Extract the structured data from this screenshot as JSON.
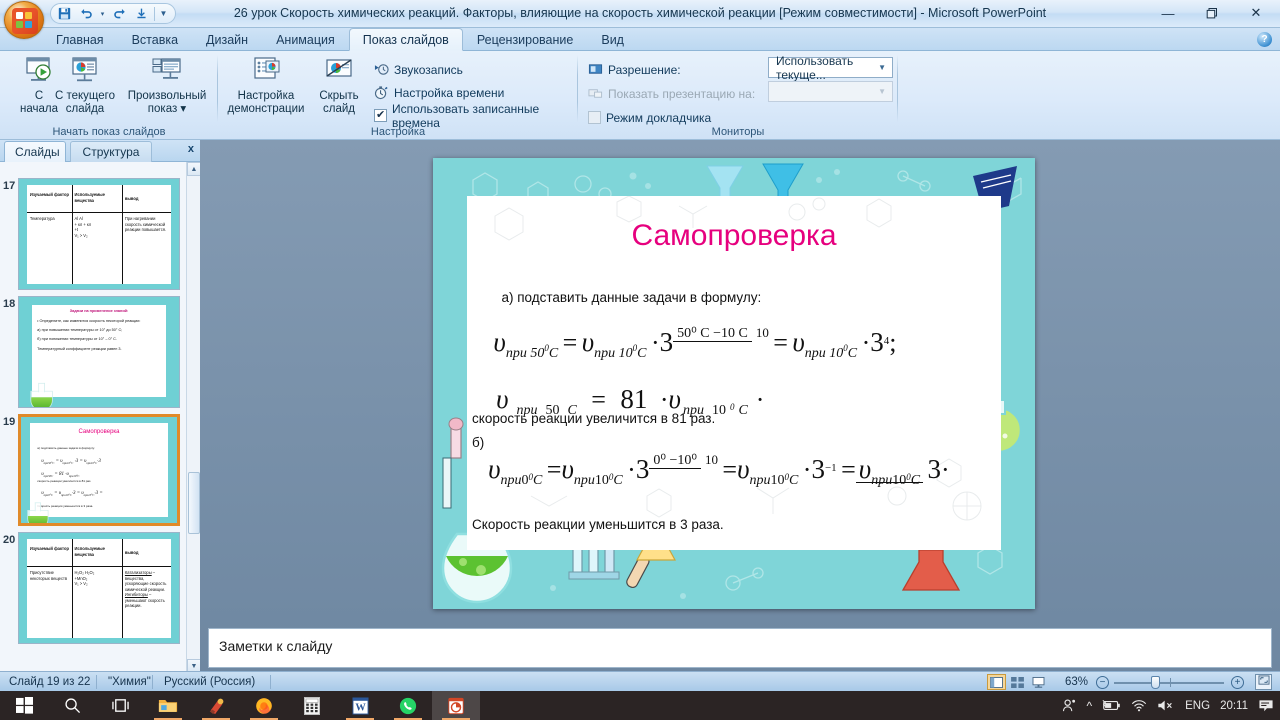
{
  "window": {
    "title": "26 урок Скорость химических реакций.  Факторы, влияющие на скорость химической реакции [Режим совместимости]  -  Microsoft PowerPoint",
    "minimize": "—",
    "restore": "❐",
    "close": "✕",
    "help": "?"
  },
  "quick_access": {
    "save": "💾",
    "undo": "↰",
    "undo_more": "▾",
    "redo": "↱",
    "start_show": "⇟",
    "customize": "▾"
  },
  "ribbon_tabs": [
    {
      "label": "Главная",
      "active": false
    },
    {
      "label": "Вставка",
      "active": false
    },
    {
      "label": "Дизайн",
      "active": false
    },
    {
      "label": "Анимация",
      "active": false
    },
    {
      "label": "Показ слайдов",
      "active": true
    },
    {
      "label": "Рецензирование",
      "active": false
    },
    {
      "label": "Вид",
      "active": false
    }
  ],
  "ribbon": {
    "group_start": {
      "label": "Начать показ слайдов",
      "buttons": [
        {
          "line1": "С",
          "line2": "начала"
        },
        {
          "line1": "С текущего",
          "line2": "слайда"
        },
        {
          "line1": "Произвольный",
          "line2": "показ ▾"
        }
      ]
    },
    "group_setup": {
      "label": "Настройка",
      "buttons": [
        {
          "line1": "Настройка",
          "line2": "демонстрации"
        },
        {
          "line1": "Скрыть",
          "line2": "слайд"
        }
      ],
      "items": [
        {
          "label": "Звукозапись",
          "type": "icon"
        },
        {
          "label": "Настройка времени",
          "type": "icon"
        },
        {
          "label": "Использовать записанные времена",
          "type": "checkbox",
          "checked": true
        }
      ]
    },
    "group_monitors": {
      "label": "Мониторы",
      "items": [
        {
          "label": "Разрешение:",
          "type": "icon",
          "disabled": false
        },
        {
          "label": "Показать презентацию на:",
          "type": "icon",
          "disabled": true
        },
        {
          "label": "Режим докладчика",
          "type": "checkbox",
          "checked": false,
          "disabled": false
        }
      ],
      "resolution_value": "Использовать текуще...",
      "show_on_value": ""
    }
  },
  "left_panel": {
    "tabs": [
      {
        "label": "Слайды",
        "active": true
      },
      {
        "label": "Структура",
        "active": false
      }
    ],
    "close": "x",
    "scroll_up": "▲",
    "scroll_down": "▼",
    "thumbnails": [
      {
        "number": "17",
        "selected": false,
        "type": "table",
        "headers": [
          "Изучаемый фактор",
          "Используемые вещества",
          "вывод"
        ],
        "cells": [
          "Температура",
          "Al                 Al\n+ кл           + кл\n+t\nV₁      >     V₂",
          "При нагревании скорость химической реакции повышается."
        ]
      },
      {
        "number": "18",
        "selected": false,
        "type": "text",
        "title": "Задачи на применение знаний:",
        "lines": [
          "• Определите, как изменится скорость некоторой реакции:",
          "  а) при повышении температуры от 10° до 50° С;",
          "  б) при понижении температуры от 10° – 0° С.",
          "Температурный коэффициент реакции равен 3."
        ]
      },
      {
        "number": "19",
        "selected": true,
        "type": "current",
        "title": "Самопроверка"
      },
      {
        "number": "20",
        "selected": false,
        "type": "table",
        "headers": [
          "Изучаемый фактор",
          "Используемые вещества",
          "вывод"
        ],
        "cells": [
          "Присутствие некоторых веществ",
          "H₂O₂              H₂O₂\n+MnO₂\nV₁      >     V₂",
          "Катализаторы – вещества, ускоряющие скорость химической реакции.\nИнгибиторы – уменьшают скорость реакции."
        ]
      }
    ]
  },
  "slide": {
    "title": "Самопроверка",
    "line_a": "а) подставить данные задачи в формулу:",
    "formula1": {
      "v1": "υ",
      "v1_sub": "при 50",
      "v1_sup": "0",
      "v1_c": "C",
      "eq": "=",
      "v2": "υ",
      "v2_sub": "при 10",
      "v2_sup": "0",
      "v2_c": "C",
      "dot": "·",
      "base": "3",
      "frac_num": "50⁰ C −10  C",
      "frac_den": "10",
      "eq2": "=",
      "v3": "υ",
      "v3_sub": "при 10",
      "v3_sup": "0",
      "v3_c": "C",
      "dot2": "·",
      "base2": "3",
      "exp2": "4",
      "tail": ";"
    },
    "formula2": {
      "v1": "υ",
      "v1_sub": "при",
      "v1_num": "50",
      "v1_c": "C",
      "eq": "=",
      "value": "81",
      "dot": "·",
      "v2": "υ",
      "v2_sub": "при",
      "v2_num": "10",
      "v2_sup": "0",
      "v2_c": "C",
      "tail": "·"
    },
    "text_after_formula2": "скорость реакции увеличится в 81 раз.",
    "line_b": "б)",
    "formula3": {
      "v1": "υ",
      "v1_sub": "при",
      "v1_num": "0",
      "v1_sup": "0",
      "v1_c": "C",
      "eq": "=",
      "v2": "υ",
      "v2_sub": "при",
      "v2_num": "10",
      "v2_sup": "0",
      "v2_c": "C",
      "dot": "·",
      "base": "3",
      "frac_num": "0⁰ −10⁰",
      "frac_den": "10",
      "eq2": "=",
      "v3": "υ",
      "v3_sub": "при",
      "v3_num": "10",
      "v3_sup": "0",
      "v3_c": "C",
      "dot2": "·",
      "base2": "3",
      "exp2": "−1",
      "eq3": "=",
      "res_num_v": "υ",
      "res_num_sub": "при",
      "res_num_n": "10",
      "res_num_sup": "0",
      "res_num_c": "C",
      "res_den": "3",
      "tail": "·"
    },
    "line_conclusion": "Скорость реакции уменьшится в 3 раза."
  },
  "notes": {
    "placeholder": "Заметки к слайду"
  },
  "status_bar": {
    "slide_counter": "Слайд 19 из 22",
    "theme": "\"Химия\"",
    "language": "Русский (Россия)",
    "zoom_level": "63%",
    "zoom_out": "−",
    "zoom_in": "+",
    "fit_to_window": "⛶",
    "views": [
      {
        "name": "normal",
        "active": true
      },
      {
        "name": "sorter",
        "active": false
      },
      {
        "name": "slideshow",
        "active": false
      }
    ]
  },
  "taskbar": {
    "items": [
      {
        "name": "start",
        "active": false
      },
      {
        "name": "search",
        "active": false
      },
      {
        "name": "task-view",
        "active": false
      },
      {
        "name": "file-explorer",
        "active": false
      },
      {
        "name": "ccleaner",
        "active": false
      },
      {
        "name": "firefox",
        "active": false
      },
      {
        "name": "calculator",
        "active": false
      },
      {
        "name": "word",
        "active": false
      },
      {
        "name": "whatsapp",
        "active": false
      },
      {
        "name": "powerpoint",
        "active": true
      }
    ],
    "tray": {
      "people": "people-icon",
      "chevron": "^",
      "battery": "battery-icon",
      "network": "network-icon",
      "volume": "volume-muted-icon",
      "language": "ENG",
      "clock": "20:11",
      "notifications": "notification-icon"
    }
  }
}
